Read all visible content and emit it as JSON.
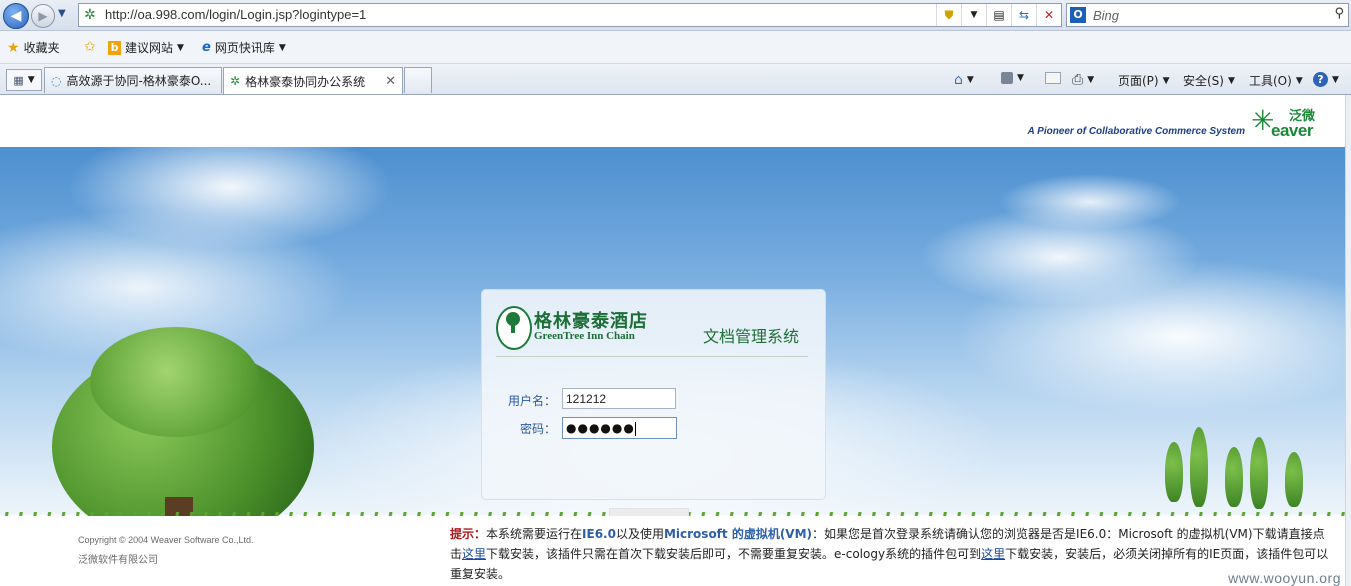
{
  "browser": {
    "url": "http://oa.998.com/login/Login.jsp?logintype=1",
    "search_placeholder": "Bing",
    "favorites": {
      "favorites_label": "收藏夹",
      "suggested_sites_label": "建议网站",
      "web_slice_label": "网页快讯库"
    },
    "tabs": [
      {
        "label": "高效源于协同-格林豪泰O..."
      },
      {
        "label": "格林豪泰协同办公系统"
      }
    ],
    "commands": {
      "page_label": "页面(P)",
      "safety_label": "安全(S)",
      "tools_label": "工具(O)"
    }
  },
  "page": {
    "brand": {
      "tagline": "A Pioneer of Collaborative Commerce System",
      "logo_cn": "泛微",
      "logo_en": "eaver"
    },
    "login": {
      "hotel_name_cn": "格林豪泰酒店",
      "hotel_name_en": "GreenTree Inn Chain",
      "system_title": "文档管理系统",
      "username_label": "用户名：",
      "username_value": "121212",
      "password_label": "密码：",
      "password_value": "●●●●●●"
    },
    "footer": {
      "copyright": "Copyright © 2004 Weaver Software Co.,Ltd.",
      "company": "泛微软件有限公司",
      "notice_label": "提示：",
      "notice_p1": "本系统需要运行在",
      "notice_ie": "IE6.0",
      "notice_p2": "以及使用",
      "notice_vm": "Microsoft 的虚拟机(VM)",
      "notice_p3": "：如果您是首次登录系统请确认您的浏览器是否是IE6.0：Microsoft 的虚拟机(VM)下载请直接点击",
      "notice_link1": "这里",
      "notice_p4": "下载安装，该插件只需在首次下载安装后即可，不需要重复安装。e-cology系统的插件包可到",
      "notice_link2": "这里",
      "notice_p5": "下载安装，安装后，必须关闭掉所有的IE页面，该插件包可以重复安装。"
    },
    "watermark": "www.wooyun.org"
  }
}
